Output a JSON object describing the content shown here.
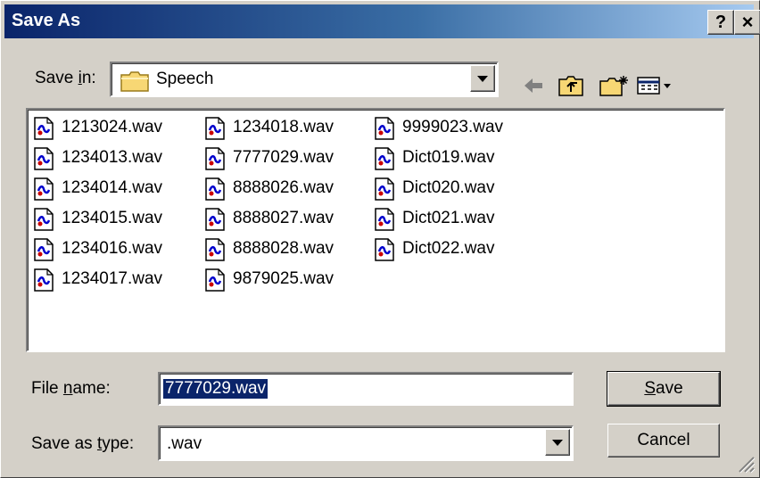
{
  "window": {
    "title": "Save As"
  },
  "title_buttons": {
    "help": "?",
    "close": "×"
  },
  "save_in": {
    "label_prefix": "Save ",
    "label_accel": "i",
    "label_suffix": "n:",
    "folder": "Speech"
  },
  "toolbar": {
    "icons": [
      "back-arrow-icon",
      "up-folder-icon",
      "new-folder-icon",
      "view-menu-icon"
    ]
  },
  "files": [
    "1213024.wav",
    "1234013.wav",
    "1234014.wav",
    "1234015.wav",
    "1234016.wav",
    "1234017.wav",
    "1234018.wav",
    "7777029.wav",
    "8888026.wav",
    "8888027.wav",
    "8888028.wav",
    "9879025.wav",
    "9999023.wav",
    "Dict019.wav",
    "Dict020.wav",
    "Dict021.wav",
    "Dict022.wav"
  ],
  "file_name": {
    "label_prefix": "File ",
    "label_accel": "n",
    "label_suffix": "ame:",
    "value": "7777029.wav"
  },
  "save_type": {
    "label_prefix": "Save as ",
    "label_accel": "t",
    "label_suffix": "ype:",
    "value": ".wav"
  },
  "buttons": {
    "save_accel": "S",
    "save_rest": "ave",
    "cancel": "Cancel"
  },
  "colors": {
    "title_active": "#0a246a",
    "face": "#d4d0c8",
    "selection": "#0a246a"
  }
}
